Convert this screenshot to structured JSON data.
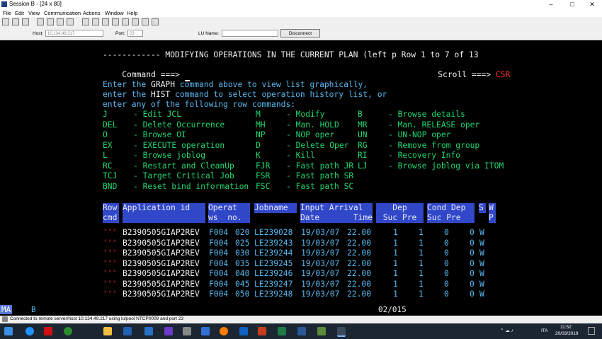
{
  "window": {
    "title": "Session B - [24 x 80]"
  },
  "menu": [
    "File",
    "Edit",
    "View",
    "Communication",
    "Actions",
    "Window",
    "Help"
  ],
  "connection": {
    "host_label": "Host:",
    "host_value": "10.134.49.217",
    "port_label": "Port:",
    "port_value": "23",
    "lu_label": "LU Name:",
    "lu_value": "",
    "disconnect": "Disconnect"
  },
  "screen": {
    "header": "------------ MODIFYING OPERATIONS IN THE CURRENT PLAN (left p Row 1 to 7 of 13",
    "command_label": "Command ===> ",
    "scroll_label": "Scroll ===> ",
    "scroll_value": "CSR",
    "instr1_a": "Enter the ",
    "instr1_b": "GRAPH",
    "instr1_c": " command above to view list graphically,",
    "instr2_a": "enter the ",
    "instr2_b": "HIST",
    "instr2_c": " command to select operation history list, or",
    "instr3": "enter any of the following row commands:",
    "commands": [
      [
        "J",
        "- Edit JCL",
        "M",
        "- Modify",
        "B",
        "- Browse details"
      ],
      [
        "DEL",
        "- Delete Occurrence",
        "MH",
        "- Man. HOLD",
        "MR",
        "- Man. RELEASE oper"
      ],
      [
        "O",
        "- Browse OI",
        "NP",
        "- NOP oper",
        "UN",
        "- UN-NOP oper"
      ],
      [
        "EX",
        "- EXECUTE operation",
        "D",
        "- Delete Oper",
        "RG",
        "- Remove from group"
      ],
      [
        "L",
        "- Browse joblog",
        "K",
        "- Kill",
        "RI",
        "- Recovery Info"
      ],
      [
        "RC",
        "- Restart and CleanUp",
        "FJR",
        "- Fast path JR",
        "LJ",
        "- Browse joblog via ITOM"
      ],
      [
        "TCJ",
        "- Target Critical Job",
        "FSR",
        "- Fast path SR",
        "",
        ""
      ],
      [
        "BND",
        "- Reset bind information",
        "FSC",
        "- Fast path SC",
        "",
        ""
      ]
    ],
    "table_headers": {
      "row1": [
        "Row",
        "Application id",
        "Operat",
        "Jobname",
        "Input Arrival",
        "Dep",
        "Cond Dep",
        "S",
        "W"
      ],
      "row2": [
        "cmd",
        "ws  no.",
        "Date       Time",
        "Suc Pre",
        "Suc Pre",
        "P"
      ]
    },
    "rows": [
      {
        "cmd": "'''",
        "app": "B2390505GIAP2REV",
        "ws": "F004",
        "no": "020",
        "job": "LE239028",
        "date": "19/03/07",
        "time": "22.00",
        "dsuc": "1",
        "dpre": "1",
        "csuc": "0",
        "cpre": "0",
        "s": "W"
      },
      {
        "cmd": "'''",
        "app": "B2390505GIAP2REV",
        "ws": "F004",
        "no": "025",
        "job": "LE239243",
        "date": "19/03/07",
        "time": "22.00",
        "dsuc": "1",
        "dpre": "1",
        "csuc": "0",
        "cpre": "0",
        "s": "W"
      },
      {
        "cmd": "'''",
        "app": "B2390505GIAP2REV",
        "ws": "F004",
        "no": "030",
        "job": "LE239244",
        "date": "19/03/07",
        "time": "22.00",
        "dsuc": "1",
        "dpre": "1",
        "csuc": "0",
        "cpre": "0",
        "s": "W"
      },
      {
        "cmd": "'''",
        "app": "B2390505GIAP2REV",
        "ws": "F004",
        "no": "035",
        "job": "LE239245",
        "date": "19/03/07",
        "time": "22.00",
        "dsuc": "1",
        "dpre": "1",
        "csuc": "0",
        "cpre": "0",
        "s": "W"
      },
      {
        "cmd": "'''",
        "app": "B2390505GIAP2REV",
        "ws": "F004",
        "no": "040",
        "job": "LE239246",
        "date": "19/03/07",
        "time": "22.00",
        "dsuc": "1",
        "dpre": "1",
        "csuc": "0",
        "cpre": "0",
        "s": "W"
      },
      {
        "cmd": "'''",
        "app": "B2390505GIAP2REV",
        "ws": "F004",
        "no": "045",
        "job": "LE239247",
        "date": "19/03/07",
        "time": "22.00",
        "dsuc": "1",
        "dpre": "1",
        "csuc": "0",
        "cpre": "0",
        "s": "W"
      },
      {
        "cmd": "'''",
        "app": "B2390505GIAP2REV",
        "ws": "F004",
        "no": "050",
        "job": "LE239248",
        "date": "19/03/07",
        "time": "22.00",
        "dsuc": "1",
        "dpre": "1",
        "csuc": "0",
        "cpre": "0",
        "s": "W"
      }
    ]
  },
  "oia": {
    "left": "MA",
    "session": "B",
    "cursor_pos": "02/015"
  },
  "status": "Connected to remote server/host 10.134.49.217 using lu/pool NTCP0009 and port 23",
  "taskbar": {
    "lang": "ITA",
    "time": "11:52",
    "date": "20/03/2019"
  },
  "colors": {
    "green": "#20d870",
    "cyan": "#58b8f0",
    "white": "#f0f0f0",
    "red": "#ff3030",
    "header_blue": "#3048c8"
  }
}
